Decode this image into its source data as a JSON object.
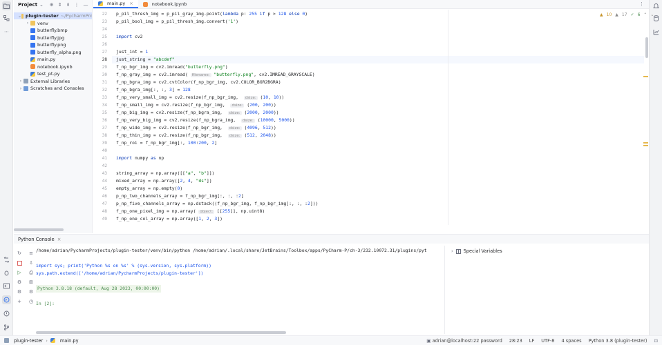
{
  "project_panel": {
    "title": "Project",
    "tree": [
      {
        "label": "plugin-tester",
        "hint": "~/PycharmPro",
        "icon": "folder-icon",
        "level": 0,
        "expanded": true,
        "bold": true
      },
      {
        "label": "venv",
        "icon": "folder-icon",
        "level": 1,
        "expanded": false
      },
      {
        "label": "butterfly.bmp",
        "icon": "image-file-icon",
        "level": 1
      },
      {
        "label": "butterfly.jpg",
        "icon": "image-file-icon",
        "level": 1
      },
      {
        "label": "butterfly.png",
        "icon": "image-file-icon",
        "level": 1
      },
      {
        "label": "butterfly_alpha.png",
        "icon": "image-file-icon",
        "level": 1
      },
      {
        "label": "main.py",
        "icon": "python-file-icon",
        "level": 1
      },
      {
        "label": "notebook.ipynb",
        "icon": "notebook-file-icon",
        "level": 1
      },
      {
        "label": "test_pt.py",
        "icon": "python-file-icon",
        "level": 1
      },
      {
        "label": "External Libraries",
        "icon": "library-icon",
        "level": 0,
        "expanded": false
      },
      {
        "label": "Scratches and Consoles",
        "icon": "scratches-icon",
        "level": 0,
        "expanded": false
      }
    ]
  },
  "editor": {
    "tabs": [
      {
        "label": "main.py",
        "active": true
      },
      {
        "label": "notebook.ipynb",
        "active": false
      }
    ],
    "inspections": {
      "warnings": "10",
      "weak_warnings": "17",
      "ok": "6"
    },
    "current_line": "28",
    "lines": [
      {
        "n": "22",
        "code": "p_pil_thresh_img = p_pil_gray_img.point(lambda p: 255 if p > 128 else 0)"
      },
      {
        "n": "23",
        "code": "p_pil_bool_img = p_pil_thresh_img.convert('1')"
      },
      {
        "n": "24",
        "code": ""
      },
      {
        "n": "25",
        "code": "import cv2"
      },
      {
        "n": "26",
        "code": ""
      },
      {
        "n": "27",
        "code": "just_int = 1"
      },
      {
        "n": "28",
        "code": "just_string = \"abcdef\""
      },
      {
        "n": "29",
        "code": "f_np_bgr_img = cv2.imread(\"butterfly.png\")"
      },
      {
        "n": "30",
        "code": "f_np_gray_img = cv2.imread( filename: \"butterfly.png\", cv2.IMREAD_GRAYSCALE)"
      },
      {
        "n": "31",
        "code": "f_np_bgra_img = cv2.cvtColor(f_np_bgr_img, cv2.COLOR_BGR2BGRA)"
      },
      {
        "n": "32",
        "code": "f_np_bgra_img[:, :, 3] = 128"
      },
      {
        "n": "33",
        "code": "f_np_very_small_img = cv2.resize(f_np_bgr_img,  dsize: (10, 10))"
      },
      {
        "n": "34",
        "code": "f_np_small_img = cv2.resize(f_np_bgr_img,  dsize: (200, 200))"
      },
      {
        "n": "35",
        "code": "f_np_big_img = cv2.resize(f_np_bgra_img,  dsize: (2000, 2000))"
      },
      {
        "n": "36",
        "code": "f_np_very_big_img = cv2.resize(f_np_bgra_img,  dsize: (10000, 5000))"
      },
      {
        "n": "37",
        "code": "f_np_wide_img = cv2.resize(f_np_bgr_img,  dsize: (4096, 512))"
      },
      {
        "n": "38",
        "code": "f_np_thin_img = cv2.resize(f_np_bgr_img,  dsize: (512, 2048))"
      },
      {
        "n": "39",
        "code": "f_np_roi = f_np_bgr_img[:, 100:200, 2]"
      },
      {
        "n": "40",
        "code": ""
      },
      {
        "n": "41",
        "code": "import numpy as np"
      },
      {
        "n": "42",
        "code": ""
      },
      {
        "n": "43",
        "code": "string_array = np.array([[\"a\", \"b\"]])"
      },
      {
        "n": "44",
        "code": "mixed_array = np.array([2, 4, \"ds\"])"
      },
      {
        "n": "45",
        "code": "empty_array = np.empty(0)"
      },
      {
        "n": "46",
        "code": "p_np_two_channels_array = f_np_bgr_img[:, :, :2]"
      },
      {
        "n": "47",
        "code": "p_np_five_channels_array = np.dstack((f_np_bgr_img, f_np_bgr_img[:, :, :2]))"
      },
      {
        "n": "48",
        "code": "f_np_one_pixel_img = np.array( object: [[255]], np.uint8)"
      },
      {
        "n": "49",
        "code": "f_np_one_col_array = np.array([1, 2, 3])"
      }
    ]
  },
  "console": {
    "title": "Python Console",
    "lines": [
      {
        "text": "/home/adrian/PycharmProjects/plugin-tester/venv/bin/python /home/adrian/.local/share/JetBrains/Toolbox/apps/PyCharm-P/ch-3/232.10072.31/plugins/pyt",
        "style": "cmd"
      },
      {
        "text": "",
        "style": "cmd"
      },
      {
        "text": "import sys; print('Python %s on %s' % (sys.version, sys.platform))",
        "style": "blue"
      },
      {
        "text": "sys.path.extend(['/home/adrian/PycharmProjects/plugin-tester'])",
        "style": "blue"
      },
      {
        "text": "",
        "style": "cmd"
      },
      {
        "text": "Python 3.8.18 (default, Aug 28 2023, 00:00:00)",
        "style": "ver"
      },
      {
        "text": "",
        "style": "cmd"
      },
      {
        "text": "In [2]:",
        "style": "prompt"
      }
    ],
    "special_variables": "Special Variables"
  },
  "status_bar": {
    "breadcrumb_project": "plugin-tester",
    "breadcrumb_file": "main.py",
    "remote": "adrian@localhost:22 password",
    "position": "28:23",
    "line_sep": "LF",
    "encoding": "UTF-8",
    "indent": "4 spaces",
    "interpreter": "Python 3.8 (plugin-tester)"
  }
}
